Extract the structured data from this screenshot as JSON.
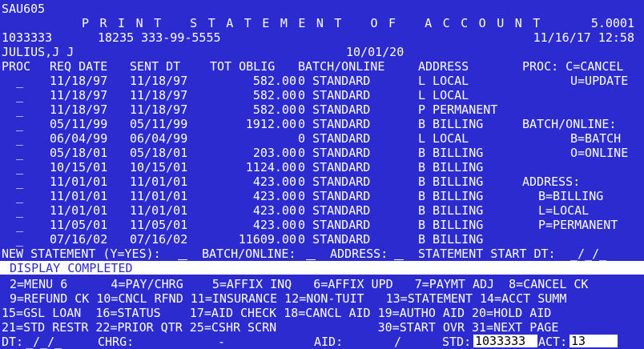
{
  "header": {
    "screen_id": "SAU605",
    "title": "PRINT STATEMENT OF ACCOUNT",
    "version": "5.0001",
    "student_id": "1033333",
    "record_info": "18235 333-99-5555",
    "date_time": "11/16/17 12:58",
    "student_name": "JULIUS,J J",
    "term_date": "10/01/20"
  },
  "columns": {
    "proc": "PROC",
    "req_date": "REQ DATE",
    "sent_dt": "SENT DT",
    "tot_oblig": "TOT OBLIG",
    "batch_online": "BATCH/ONLINE",
    "address": "ADDRESS"
  },
  "rows": [
    {
      "proc": "_",
      "req_date": "11/18/97",
      "sent_dt": "11/18/97",
      "tot_oblig": "582.00",
      "batch": "0 STANDARD",
      "address": "L LOCAL"
    },
    {
      "proc": "_",
      "req_date": "11/18/97",
      "sent_dt": "11/18/97",
      "tot_oblig": "582.00",
      "batch": "0 STANDARD",
      "address": "L LOCAL"
    },
    {
      "proc": "_",
      "req_date": "11/18/97",
      "sent_dt": "11/18/97",
      "tot_oblig": "582.00",
      "batch": "0 STANDARD",
      "address": "P PERMANENT"
    },
    {
      "proc": "_",
      "req_date": "05/11/99",
      "sent_dt": "05/11/99",
      "tot_oblig": "1912.00",
      "batch": "0 STANDARD",
      "address": "B BILLING"
    },
    {
      "proc": "_",
      "req_date": "06/04/99",
      "sent_dt": "06/04/99",
      "tot_oblig": "",
      "batch": "0 STANDARD",
      "address": "L LOCAL"
    },
    {
      "proc": "_",
      "req_date": "05/18/01",
      "sent_dt": "05/18/01",
      "tot_oblig": "203.00",
      "batch": "0 STANDARD",
      "address": "B BILLING"
    },
    {
      "proc": "_",
      "req_date": "10/15/01",
      "sent_dt": "10/15/01",
      "tot_oblig": "1124.00",
      "batch": "0 STANDARD",
      "address": "B BILLING"
    },
    {
      "proc": "_",
      "req_date": "11/01/01",
      "sent_dt": "11/01/01",
      "tot_oblig": "423.00",
      "batch": "0 STANDARD",
      "address": "B BILLING"
    },
    {
      "proc": "_",
      "req_date": "11/01/01",
      "sent_dt": "11/01/01",
      "tot_oblig": "423.00",
      "batch": "0 STANDARD",
      "address": "B BILLING"
    },
    {
      "proc": "_",
      "req_date": "11/01/01",
      "sent_dt": "11/01/01",
      "tot_oblig": "423.00",
      "batch": "0 STANDARD",
      "address": "B BILLING"
    },
    {
      "proc": "_",
      "req_date": "11/05/01",
      "sent_dt": "11/05/01",
      "tot_oblig": "423.00",
      "batch": "0 STANDARD",
      "address": "B BILLING"
    },
    {
      "proc": "_",
      "req_date": "07/16/02",
      "sent_dt": "07/16/02",
      "tot_oblig": "11609.00",
      "batch": "0 STANDARD",
      "address": "B BILLING"
    }
  ],
  "legend": {
    "proc_title": "PROC: C=CANCEL",
    "proc_u": "U=UPDATE",
    "batch_title": "BATCH/ONLINE:",
    "batch_b": "B=BATCH",
    "batch_o": "O=ONLINE",
    "addr_title": "ADDRESS:",
    "addr_b": "B=BILLING",
    "addr_l": "L=LOCAL",
    "addr_p": "P=PERMANENT"
  },
  "entry": {
    "new_statement": "NEW STATEMENT (Y=YES):",
    "batch_online": "BATCH/ONLINE:",
    "address": "ADDRESS:",
    "start_dt": "STATEMENT START DT:",
    "start_dt_value": "_/_/_"
  },
  "message": "DISPLAY COMPLETED",
  "function_keys": {
    "row1": "2=MENU 6      4=PAY/CHRG    5=AFFIX INQ   6=AFFIX UPD   7=PAYMT ADJ  8=CANCEL CK",
    "row2": "9=REFUND CK 10=CNCL RFND 11=INSURANCE 12=NON-TUIT   13=STATEMENT 14=ACCT SUMM",
    "row3": "15=GSL LOAN  16=STATUS    17=AID CHECK 18=CANCL AID 19=AUTHO AID 20=HOLD AID",
    "row4": "21=STD RESTR 22=PRIOR QTR 25=CSHR SCRN              30=START OVR 31=NEXT PAGE"
  },
  "footer": {
    "dt_label": "DT:",
    "dt_value": "_/_/_",
    "chrg_label": "CHRG:",
    "chrg_value": "-",
    "aid_label": "AID:",
    "aid_value": "/",
    "std_label": "STD:",
    "std_value": "1033333",
    "act_label": "ACT:",
    "act_value": "13"
  }
}
